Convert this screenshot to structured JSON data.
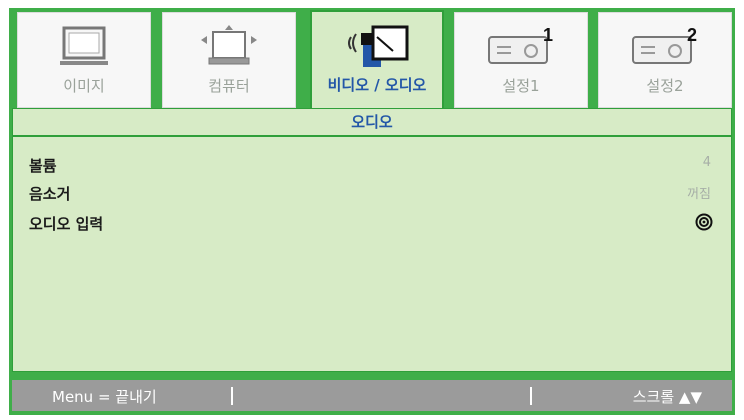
{
  "tabs": [
    {
      "label": "이미지",
      "icon": "image-monitor-icon",
      "active": false
    },
    {
      "label": "컴퓨터",
      "icon": "computer-icon",
      "active": false
    },
    {
      "label": "비디오 / 오디오",
      "icon": "video-audio-icon",
      "active": true
    },
    {
      "label": "설정1",
      "icon": "projector-settings-1-icon",
      "active": false
    },
    {
      "label": "설정2",
      "icon": "projector-settings-2-icon",
      "active": false
    }
  ],
  "panel": {
    "title": "오디오",
    "items": [
      {
        "label": "볼륨",
        "value": "4"
      },
      {
        "label": "음소거",
        "value": "꺼짐"
      },
      {
        "label": "오디오 입력",
        "value_icon": "target-icon"
      }
    ]
  },
  "footer": {
    "left": "Menu = 끝내기",
    "right": "스크롤 ▲▼"
  },
  "colors": {
    "frame": "#3fae49",
    "panel": "#d7ebc6",
    "active_text": "#2357a8",
    "footer": "#9b9b9b"
  }
}
